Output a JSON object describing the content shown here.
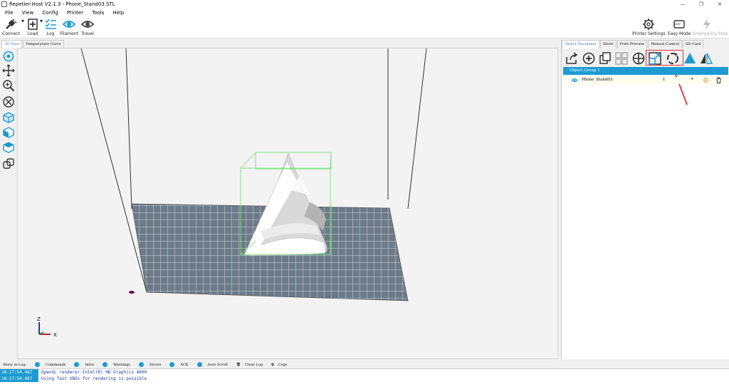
{
  "window": {
    "title": "Repetier-Host V2.1.3 - Phone_Stand03.STL",
    "minimize": "—",
    "maximize": "❐",
    "close": "✕"
  },
  "menu": [
    "File",
    "View",
    "Config",
    "Printer",
    "Tools",
    "Help"
  ],
  "toolbar": {
    "connect": "Connect",
    "load": "Load",
    "log": "Log",
    "filament": "Filament",
    "travel": "Travel",
    "printer_settings": "Printer Settings",
    "easy_mode": "Easy Mode",
    "emergency_stop": "Emergency Stop",
    "easy_badge": "EASY"
  },
  "main_tabs": [
    "3D View",
    "Temperature Curve"
  ],
  "right_tabs": [
    "Object Placement",
    "Slicer",
    "Print Preview",
    "Manual Control",
    "SD Card"
  ],
  "objects": {
    "group": "Object Group 1",
    "items": [
      {
        "name": "Phone_Stand03",
        "count": "1"
      }
    ]
  },
  "axes": {
    "z": "Z",
    "x": "X"
  },
  "log": {
    "show_in_log": "Show in Log:",
    "filters": [
      "Commands",
      "Infos",
      "Warnings",
      "Errors",
      "ACK",
      "Auto Scroll"
    ],
    "clear": "Clear Log",
    "copy": "Copy",
    "lines": [
      {
        "time": "16:17:54.487",
        "text": "OpenGL renderer:Intel(R) HD Graphics 4600"
      },
      {
        "time": "16:17:54.487",
        "text": "Using fast VBOs for rendering is possible"
      }
    ]
  },
  "colors": {
    "accent": "#1b9bd1",
    "highlight": "#e0323c",
    "bed": "#6d7b89",
    "bbox": "#7be37e"
  }
}
